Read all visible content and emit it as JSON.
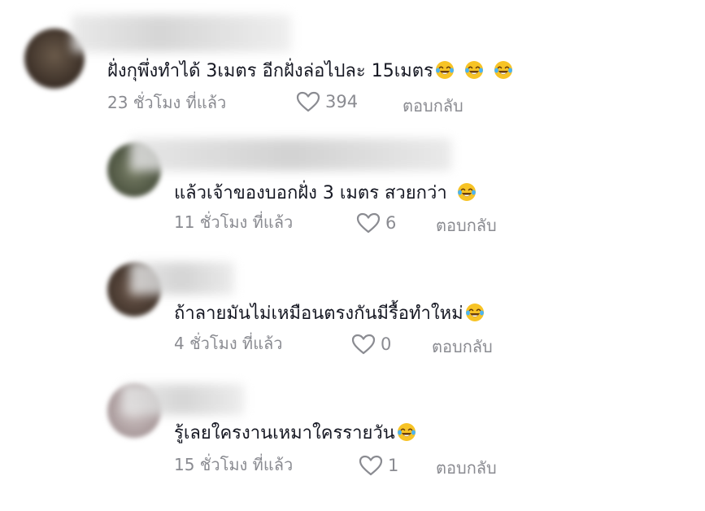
{
  "comments": [
    {
      "text": "ฝั่งกุพึ่งทำได้ 3เมตร อีกฝั่งล่อไปละ 15เมตร",
      "emoji_count": 3,
      "time": "23 ชั่วโมง ที่แล้ว",
      "likes": "394",
      "reply": "ตอบกลับ"
    },
    {
      "text": "แล้วเจ้าของบอกฝั่ง 3 เมตร สวยกว่า",
      "emoji_count": 1,
      "time": "11 ชั่วโมง ที่แล้ว",
      "likes": "6",
      "reply": "ตอบกลับ"
    },
    {
      "text": "ถ้าลายมันไม่เหมือนตรงกันมีรื้อทำใหม่",
      "emoji_count": 1,
      "time": "4 ชั่วโมง ที่แล้ว",
      "likes": "0",
      "reply": "ตอบกลับ"
    },
    {
      "text": "รู้เลยใครงานเหมาใครรายวัน",
      "emoji_count": 1,
      "time": "15 ชั่วโมง ที่แล้ว",
      "likes": "1",
      "reply": "ตอบกลับ"
    }
  ],
  "icons": {
    "emoji": "face-with-tears-of-joy-icon",
    "like": "heart-outline-icon"
  },
  "colors": {
    "text": "#161823",
    "meta": "#8a8b91",
    "emoji": "#f7c325"
  }
}
